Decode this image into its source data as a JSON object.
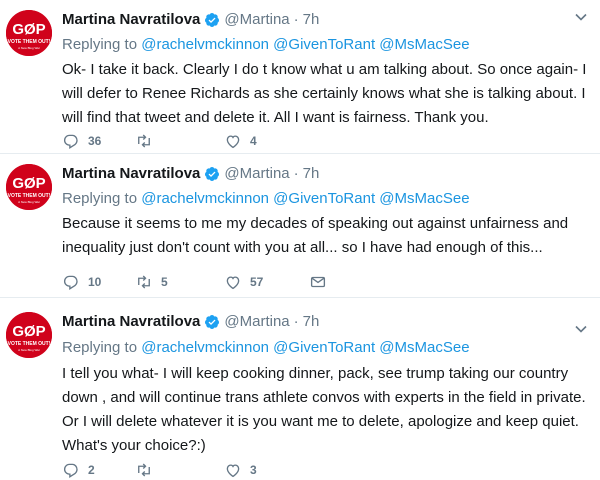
{
  "tweets": [
    {
      "name": "Martina Navratilova",
      "handle": "@Martina",
      "sep": "·",
      "time": "7h",
      "replying_label": "Replying to",
      "mentions": [
        "@rachelvmckinnon",
        "@GivenToRant",
        "@MsMacSee"
      ],
      "text": "Ok- I take it back. Clearly I do t know what u am talking about. So once again- I will defer to Renee Richards as she certainly knows what she is talking about. I will find that tweet and delete it. All I want is fairness. Thank you.",
      "counts": {
        "replies": "36",
        "retweets": "",
        "likes": "4"
      }
    },
    {
      "name": "Martina Navratilova",
      "handle": "@Martina",
      "sep": "·",
      "time": "7h",
      "replying_label": "Replying to",
      "mentions": [
        "@rachelvmckinnon",
        "@GivenToRant",
        "@MsMacSee"
      ],
      "text": "Because it seems to me my decades of speaking out against unfairness and inequality just don't count with you at all... so I have had enough of this...",
      "counts": {
        "replies": "10",
        "retweets": "5",
        "likes": "57"
      }
    },
    {
      "name": "Martina Navratilova",
      "handle": "@Martina",
      "sep": "·",
      "time": "7h",
      "replying_label": "Replying to",
      "mentions": [
        "@rachelvmckinnon",
        "@GivenToRant",
        "@MsMacSee"
      ],
      "text": "I tell you what- I will keep cooking dinner, pack, see trump taking our country down , and will continue trans athlete convos with experts in the field in private. Or I will delete whatever it is you want me to delete, apologize and keep quiet. What's your choice?:)",
      "counts": {
        "replies": "2",
        "retweets": "",
        "likes": "3"
      }
    }
  ],
  "avatar": {
    "top": "GØP",
    "bottom": "VOTE THEM OUT!",
    "tiny": "A New Blog War"
  },
  "colors": {
    "link": "#1b95e0",
    "muted": "#657786",
    "avatar_red": "#d0021b",
    "verified": "#1da1f2"
  },
  "icons": [
    "reply-icon",
    "retweet-icon",
    "like-icon",
    "dm-icon",
    "verified-icon",
    "chevron-down-icon"
  ]
}
